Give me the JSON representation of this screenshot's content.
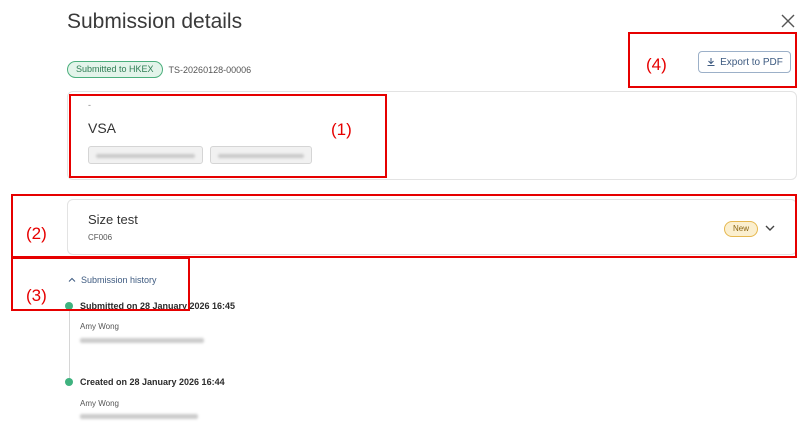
{
  "header": {
    "title": "Submission details"
  },
  "status": {
    "badge": "Submitted to HKEX",
    "reference": "TS-20260128-00006"
  },
  "toolbar": {
    "export_label": "Export to PDF"
  },
  "entity_card": {
    "dash": "-",
    "name": "VSA"
  },
  "form_card": {
    "name": "Size test",
    "code": "CF006",
    "badge": "New"
  },
  "history": {
    "toggle_label": "Submission history",
    "events": [
      {
        "title": "Submitted on 28 January 2026 16:45",
        "user": "Amy Wong"
      },
      {
        "title": "Created on 28 January 2026 16:44",
        "user": "Amy Wong"
      }
    ]
  },
  "annotations": {
    "a1": "(1)",
    "a2": "(2)",
    "a3": "(3)",
    "a4": "(4)"
  },
  "colors": {
    "accent": "#3d5a80",
    "success": "#3fb27f",
    "annotation": "#e60000",
    "warning_badge": "#fbefcf"
  }
}
